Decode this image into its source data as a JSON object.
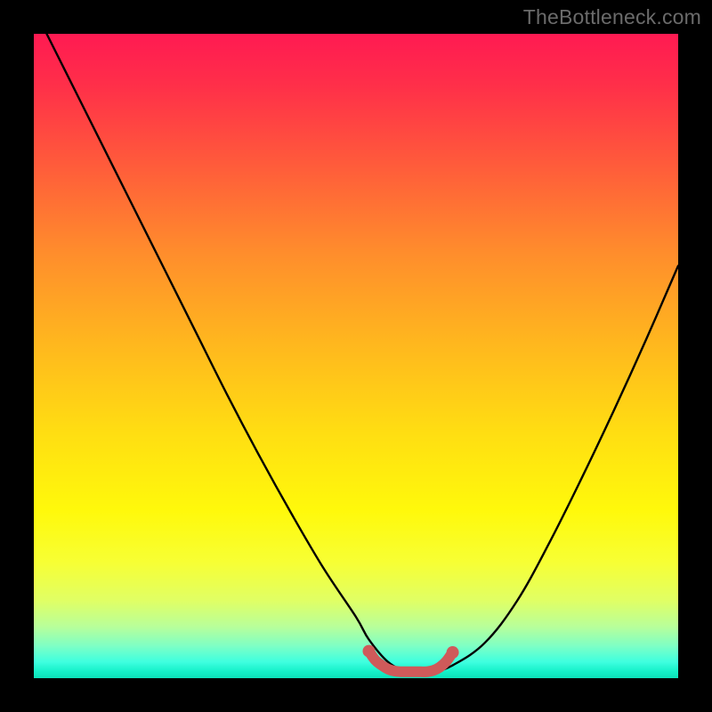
{
  "watermark": "TheBottleneck.com",
  "colors": {
    "curve": "#000000",
    "highlight": "#cf5a5a",
    "background_top": "#ff1a52",
    "background_bottom": "#0de0b8"
  },
  "chart_data": {
    "type": "line",
    "title": "",
    "xlabel": "",
    "ylabel": "",
    "xlim": [
      0,
      100
    ],
    "ylim": [
      0,
      100
    ],
    "grid": false,
    "legend": false,
    "series": [
      {
        "name": "bottleneck-curve",
        "x": [
          0,
          5,
          10,
          15,
          20,
          25,
          30,
          35,
          40,
          45,
          50,
          52,
          55,
          58,
          60,
          62,
          65,
          70,
          75,
          80,
          85,
          90,
          95,
          100
        ],
        "y": [
          104,
          94,
          84,
          74,
          64,
          54,
          44,
          34.5,
          25.5,
          17,
          9.5,
          6,
          2.5,
          1,
          1,
          1,
          2,
          5.5,
          12,
          21,
          31,
          41.5,
          52.5,
          64
        ]
      },
      {
        "name": "valley-highlight",
        "x": [
          52,
          53,
          54,
          55,
          56,
          57,
          58,
          59,
          60,
          61,
          62,
          63,
          64,
          65
        ],
        "y": [
          4.2,
          2.8,
          2.0,
          1.4,
          1.1,
          1.0,
          1.0,
          1.0,
          1.0,
          1.0,
          1.2,
          1.7,
          2.6,
          4.0
        ]
      }
    ]
  }
}
